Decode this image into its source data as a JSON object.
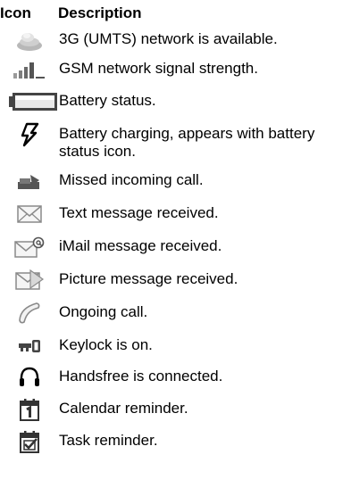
{
  "headers": {
    "icon": "Icon",
    "description": "Description"
  },
  "rows": [
    {
      "icon": "3g-umts-icon",
      "description": "3G (UMTS) network is available."
    },
    {
      "icon": "gsm-signal-icon",
      "description": "GSM network signal strength."
    },
    {
      "icon": "battery-icon",
      "description": "Battery status."
    },
    {
      "icon": "battery-charging-icon",
      "description": "Battery charging, appears with battery status icon."
    },
    {
      "icon": "missed-call-icon",
      "description": "Missed incoming call."
    },
    {
      "icon": "text-message-icon",
      "description": "Text message received."
    },
    {
      "icon": "imail-message-icon",
      "description": "iMail message received."
    },
    {
      "icon": "picture-message-icon",
      "description": "Picture message received."
    },
    {
      "icon": "ongoing-call-icon",
      "description": "Ongoing call."
    },
    {
      "icon": "keylock-icon",
      "description": "Keylock is on."
    },
    {
      "icon": "handsfree-icon",
      "description": "Handsfree is connected."
    },
    {
      "icon": "calendar-reminder-icon",
      "description": "Calendar reminder."
    },
    {
      "icon": "task-reminder-icon",
      "description": "Task reminder."
    }
  ]
}
